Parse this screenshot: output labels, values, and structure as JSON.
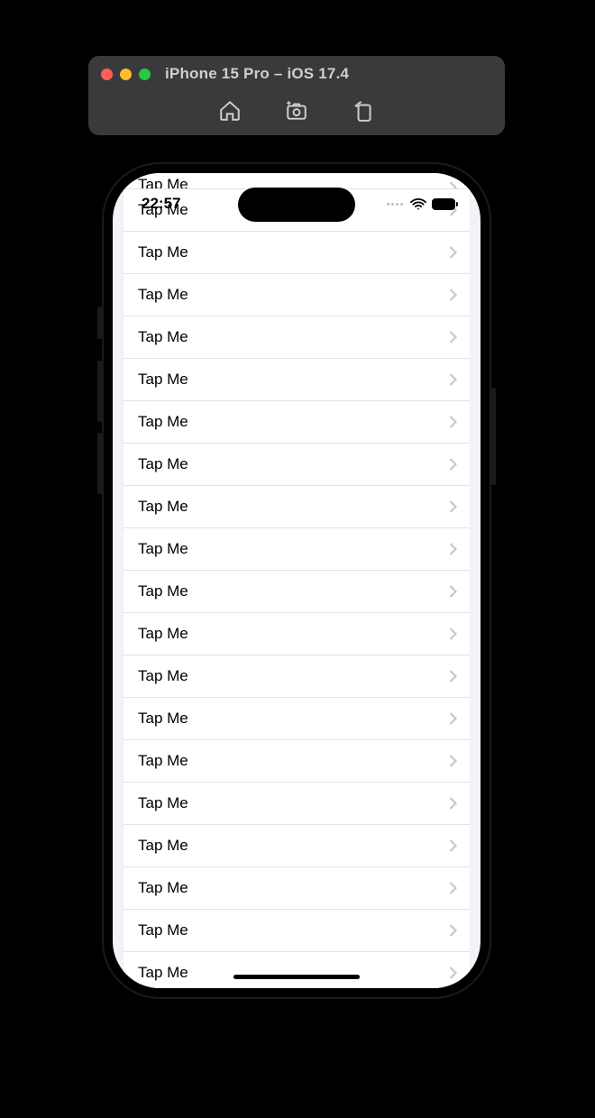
{
  "simulator": {
    "title": "iPhone 15 Pro – iOS 17.4"
  },
  "statusBar": {
    "time": "22:57"
  },
  "list": {
    "items": [
      {
        "label": "Tap Me"
      },
      {
        "label": "Tap Me"
      },
      {
        "label": "Tap Me"
      },
      {
        "label": "Tap Me"
      },
      {
        "label": "Tap Me"
      },
      {
        "label": "Tap Me"
      },
      {
        "label": "Tap Me"
      },
      {
        "label": "Tap Me"
      },
      {
        "label": "Tap Me"
      },
      {
        "label": "Tap Me"
      },
      {
        "label": "Tap Me"
      },
      {
        "label": "Tap Me"
      },
      {
        "label": "Tap Me"
      },
      {
        "label": "Tap Me"
      },
      {
        "label": "Tap Me"
      },
      {
        "label": "Tap Me"
      },
      {
        "label": "Tap Me"
      },
      {
        "label": "Tap Me"
      },
      {
        "label": "Tap Me"
      },
      {
        "label": "Tap Me"
      }
    ]
  }
}
